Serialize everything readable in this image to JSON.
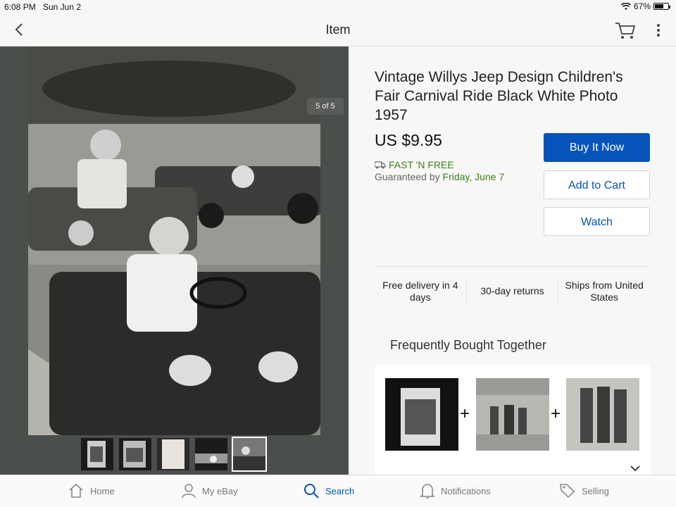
{
  "status_bar": {
    "time": "6:08 PM",
    "date": "Sun Jun 2",
    "battery": "67%",
    "battery_level": 0.67
  },
  "nav": {
    "title": "Item",
    "back_icon": "chevron-left-icon",
    "cart_icon": "cart-icon",
    "more_icon": "more-vertical-icon"
  },
  "gallery": {
    "counter": "5 of 5",
    "thumbnail_count": 5,
    "selected_index": 4
  },
  "item": {
    "title": "Vintage Willys Jeep Design Children's Fair Carnival Ride Black White Photo 1957",
    "price": "US $9.95",
    "shipping_label": "FAST 'N FREE",
    "guarantee_prefix": "Guaranteed by",
    "guarantee_date": "Friday, June 7",
    "accent_color": "#0654ba",
    "shipping_color": "#3d7f1f"
  },
  "actions": {
    "buy_now": "Buy It Now",
    "add_to_cart": "Add to Cart",
    "watch": "Watch"
  },
  "features": [
    {
      "label": "Free delivery in 4 days"
    },
    {
      "label": "30-day returns"
    },
    {
      "label": "Ships from United States"
    }
  ],
  "fbt": {
    "title": "Frequently Bought Together",
    "plus": "+"
  },
  "tabs": [
    {
      "label": "Home",
      "icon": "home-icon"
    },
    {
      "label": "My eBay",
      "icon": "user-icon"
    },
    {
      "label": "Search",
      "icon": "search-icon",
      "active": true
    },
    {
      "label": "Notifications",
      "icon": "bell-icon"
    },
    {
      "label": "Selling",
      "icon": "tag-icon"
    }
  ]
}
